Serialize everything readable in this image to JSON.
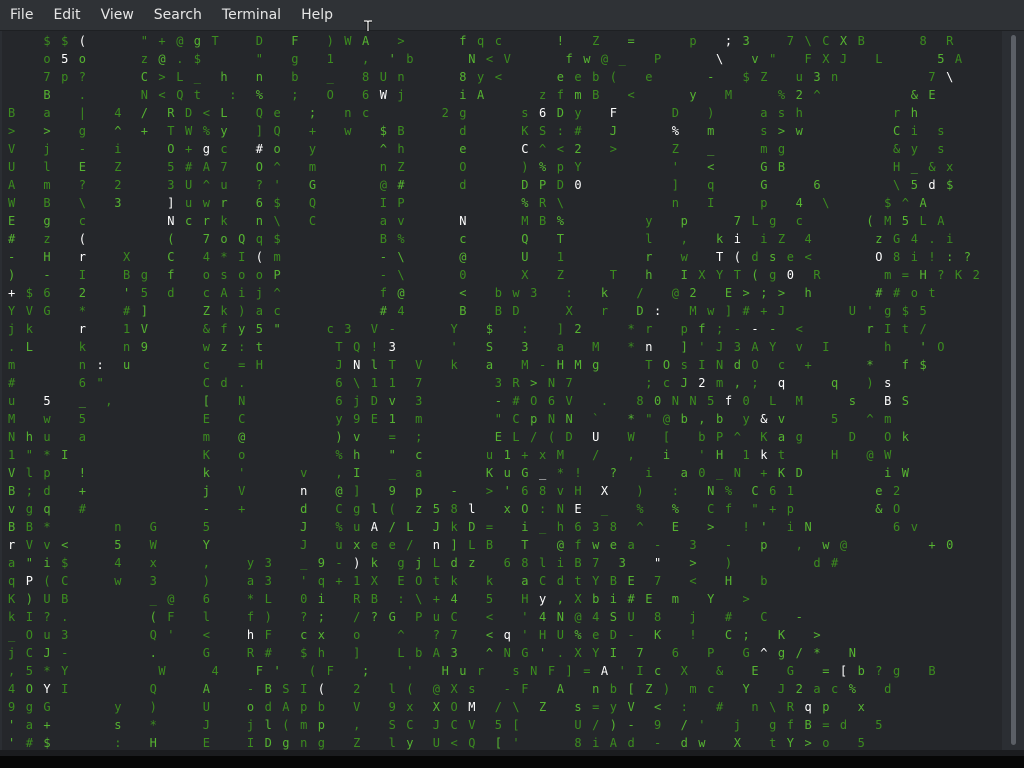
{
  "menubar": {
    "items": [
      "File",
      "Edit",
      "View",
      "Search",
      "Terminal",
      "Help"
    ]
  },
  "terminal": {
    "program_output": "matrix-style falling characters",
    "palette": {
      "background": "#25272b",
      "glyph_green": "#3c8c1f",
      "glyph_green_bright": "#56b431",
      "glyph_head": "#ffffff"
    },
    "rows": [
      "    $ $ (      \" + @ g T    D   F   ) W A   >      f q c      !   Z   =      p   ; 3    7 \\ C X B      8  R  ",
      "    o 5 o      z @ . $      \"   g   1   ,  ' b      N < V      f w @ _   P      \\   v \"   F X J   L      5 A ",
      "    7 p ?      C > L _  h   n   b   _   8 U n      8 y <      e e b (   e      -   $ Z   u 3 n          7 \\ ",
      "    B   .      N < Q t   :  %   ;   O   6 W j      i A      z f m B   <      y   M     % 2 ^          & E  ",
      "B   a   |   4  /  R D < L   Q e   ;   n c        2 g      s 6 D y   F      D   )     a s h          r h   ",
      ">   >   g   ^  +  T W % y   ] Q   +   w   $ B      d      K S : #   J      %   m     s > w          C i  s",
      "V   j   -   i     O + g c   # o   y       ^ h      e      C ^ < 2   >      Z   _     m g            & y  s",
      "U   l   E   Z     5 # A 7   O ^   m       n Z      O      ) % p Y          '   <     G B            H _ & x",
      "A   m   ?   2     3 U ^ u   ? '   G       @ #      d      D P D 0          ]   q     G     6        \\ 5 d $",
      "W   B   \\   3     ] u w r   6 $   Q       I P             % R \\            n   I     p   4  \\      $ ^ A ",
      "E   g   c         N c r k   n \\   C       a v      N      M B %         y   p     7 L g  c       ( M 5 L A",
      "#   z   (         (   7 o Q q $           B %      c      Q   T         l   ,   k i  i Z  4       z G 4 . i",
      "-   H   r    X    C   4 * I ( m           - \\      @      U   1         r   w   T ( d s e <       O 8 i ! : ?",
      ")   -   I    B g  f   o s o o P           - \\      0      X   Z     T   h   I X Y T ( g 0  R       m = H ? K 2",
      "+ $ 6   2    ' 5  d   c A i j ^           f @      <   b w 3   :   k   /   @ 2   E > ; >  h       # # o t",
      "Y V G   *    # ]      Z k ) a c           # 4      B   B D     X   r   D :   M w ] # + J       U ' g $ 5",
      "j k     r    1 V      & f y 5 \"     c 3  V -      Y   $   :   ] 2     * r   p f ; - - -  <       r I t / ",
      ". L     k    n 9      w z : t        T Q ! 3      '   S   3   a   M   * n   ] ' J 3 A Y  v  I      h   ' O ",
      "m       n :  u        c   = H        J N l T  V   k   a   M - H M g     T O s I N d O  c  +      *   f $",
      "#       6 \"           C d .          6 \\ 1 1  7        3 R > N 7        ; c J 2 m , ;  q     q   ) s",
      "u   5   _  ,          [   N          6 j D v  3        - # O 6 V   .   8 0 N N 5 f 0  L  M     s   B S",
      "M   w   5             E   C          y 9 E 1  m        \" C p N N  `   * \" @ b , b  y & v     5   ^ m",
      "N h u   a             m   @          ) v   =  ;        E L / ( D  U   W   [   b P ^  K a g     D   O k",
      "1 \" * I               K   o          % h   \"  c       u 1 + x M   /   ,   i   ' H  1 k t     H   @ W",
      "V l p   !             k   '      v   , I   _  a       K u G _ * !   ?   i   a 0 _ N  + K D         i W",
      "B ; d   +             j   V      n   @ ]   9  p   -   > ' 6 8 v H  X   )   :   N %  C 6 1         e 2",
      "v g q   #             -   +      d   C g l (  z 5 8 l   x O : N E  _   %   %   C f  \" + p         & O",
      "B B *       n   G     5          J   % u A / L  J k D =   i _ h 6 3 8  ^   E   >   ! '  i N         6 v",
      "r V v <     5   W     Y          J   u x e e /  n ] L B   T   @ f w e a  -   3   -   p   ,  w @         + 0",
      "a \" i $     4   x     ,    y 3   _ 9 - ) k  g j L d z   6 8 l i B 7  3   \"   >   )         d #",
      "q P ( C     w   3     )    a 3   ' q + 1 X  E O t k   k   a C d t Y B E  7   <   H   b",
      "K ) U B         _ @   6    * L   0 i   R B  : \\ + 4   5   H y , X b i # E  m   Y   >",
      "k I ? .         ( F   l    f )   ? ;   / ? G  P u C   <   ' 4 N @ 4 S U  8   j   #   C   -",
      "_ O u 3         Q '   <    h F   c x   o    ^   ? 7   < q ' H U % e D -  K   !   C ;   K   >",
      "j C J -         .     G    R #   $ h   ]    L b A 3   ^ N G ' . X Y I  7   6   P   G ^ g / *   N",
      ", 5 * Y          W     4    F '   ( F   ;    '   H u r   s N F ] = A ' I c  X   &   E   G   = [ b ? g   B",
      "4 O Y I         Q     A    - B S I (   2   l (  @ X s   - F   A   n b [ Z )  m c   Y   J 2 a c %   d",
      "9 g G       y   )     U    o d A p b   V   9 x  X O M  / \\  Z   s = y V  <  :   #   n \\ R q p   x",
      "' a +       s   *     J    j l ( m p   ,   S C  J C V  5 [      U / ) -  9  / '   j   g f B = d   5",
      "' # $       :   H     E    I D g n g   Z   l y  U < Q  [ '      8 i A d  -  d w   X   t Y > o   5"
    ]
  }
}
